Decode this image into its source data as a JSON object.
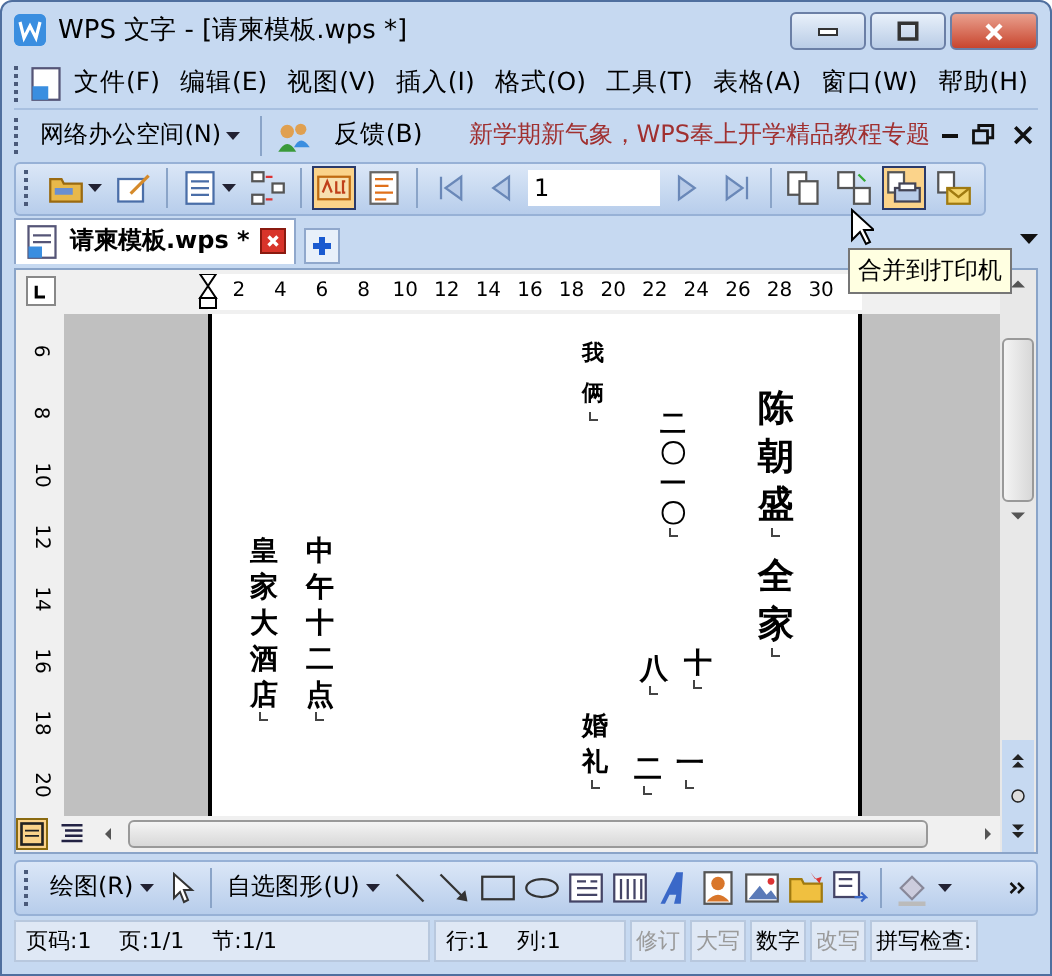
{
  "window": {
    "title": "WPS 文字 - [请柬模板.wps *]"
  },
  "menu": [
    {
      "label": "文件(F)"
    },
    {
      "label": "编辑(E)"
    },
    {
      "label": "视图(V)"
    },
    {
      "label": "插入(I)"
    },
    {
      "label": "格式(O)"
    },
    {
      "label": "工具(T)"
    },
    {
      "label": "表格(A)"
    },
    {
      "label": "窗口(W)"
    },
    {
      "label": "帮助(H)"
    }
  ],
  "office_bar": {
    "workspace": "网络办公空间(N)",
    "feedback": "反馈(B)",
    "promo": "新学期新气象，WPS奉上开学精品教程专题"
  },
  "toolbar": [
    {
      "kind": "dropdown",
      "selected": false
    },
    {
      "kind": "button",
      "selected": false
    },
    {
      "kind": "separator"
    },
    {
      "kind": "dropdown",
      "selected": false
    },
    {
      "kind": "button",
      "selected": false
    },
    {
      "kind": "separator"
    },
    {
      "kind": "button",
      "selected": true
    },
    {
      "kind": "button",
      "selected": false
    },
    {
      "kind": "separator"
    },
    {
      "kind": "button",
      "selected": false
    },
    {
      "kind": "button",
      "selected": false
    },
    {
      "kind": "field",
      "value": "1"
    },
    {
      "kind": "button",
      "selected": false
    },
    {
      "kind": "button",
      "selected": false
    },
    {
      "kind": "separator"
    },
    {
      "kind": "button",
      "selected": false
    },
    {
      "kind": "button",
      "selected": false
    },
    {
      "kind": "button",
      "selected": true
    },
    {
      "kind": "button",
      "selected": false
    }
  ],
  "tooltip": "合并到打印机",
  "tabs": [
    {
      "label": "请柬模板.wps *",
      "selected": true
    }
  ],
  "horizontal_ruler": [
    "2",
    "4",
    "6",
    "8",
    "10",
    "12",
    "14",
    "16",
    "18",
    "20",
    "22",
    "24",
    "26",
    "28",
    "30"
  ],
  "vertical_ruler": [
    "6",
    "8",
    "10",
    "12",
    "14",
    "16",
    "18",
    "20"
  ],
  "document": [
    {
      "text": "我俩"
    },
    {
      "text": "二〇一〇"
    },
    {
      "text": "陈朝盛"
    },
    {
      "text": "全家"
    },
    {
      "text": "十"
    },
    {
      "text": "八"
    },
    {
      "text": "皇家大酒店"
    },
    {
      "text": "中午十二点"
    },
    {
      "text": "婚礼"
    },
    {
      "text": "二"
    },
    {
      "text": "一"
    }
  ],
  "drawing_toolbar": {
    "draw": "绘图(R)",
    "autoshapes": "自选图形(U)"
  },
  "status_bar": [
    {
      "text": "页码:1",
      "disabled": false
    },
    {
      "text": "页:1/1",
      "disabled": false
    },
    {
      "text": "节:1/1",
      "disabled": false
    },
    {
      "text": "行:1",
      "disabled": false
    },
    {
      "text": "列:1",
      "disabled": false
    },
    {
      "text": "修订",
      "disabled": true
    },
    {
      "text": "大写",
      "disabled": true
    },
    {
      "text": "数字",
      "disabled": false
    },
    {
      "text": "改写",
      "disabled": true
    },
    {
      "text": "拼写检查:",
      "disabled": false
    }
  ]
}
